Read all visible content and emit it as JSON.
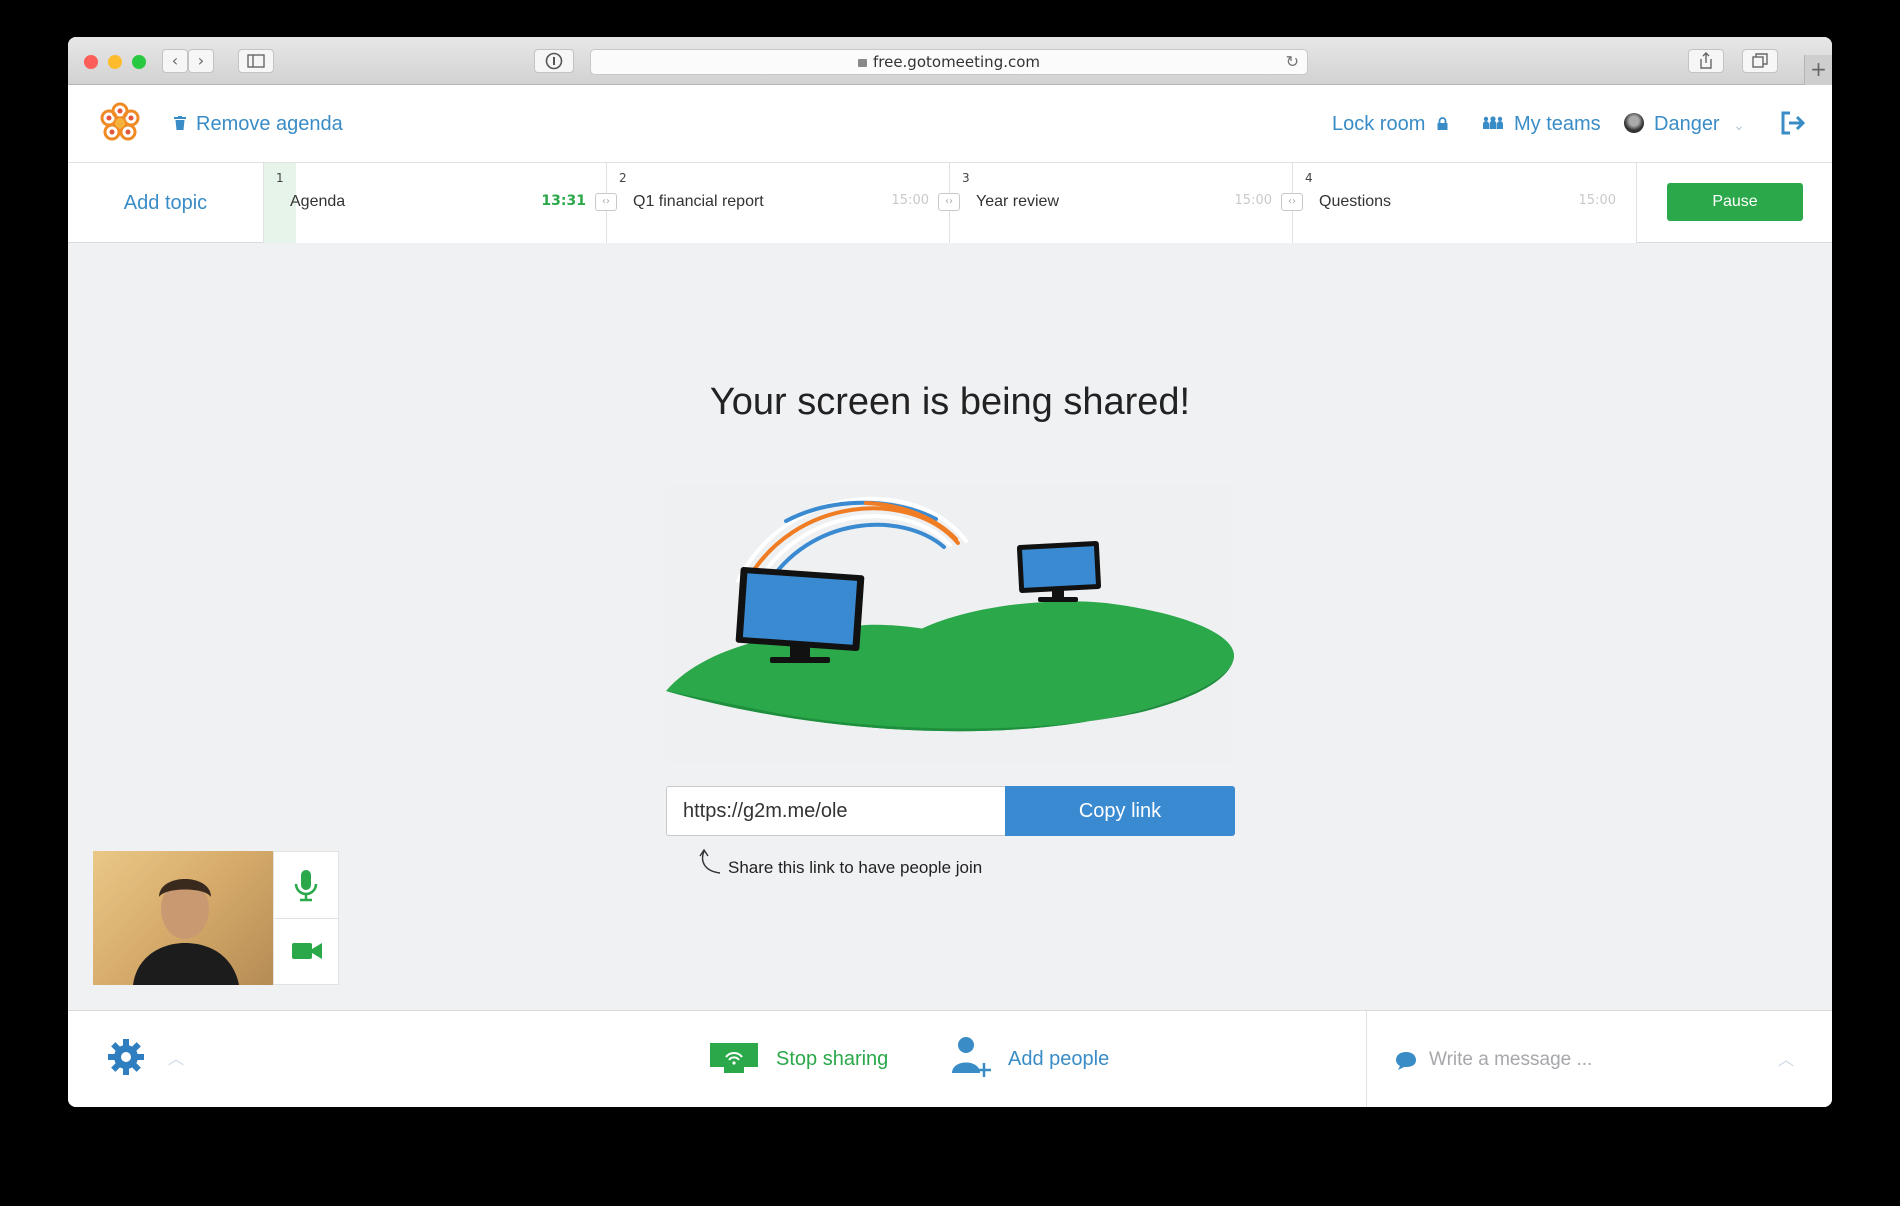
{
  "browser": {
    "url": "free.gotomeeting.com"
  },
  "header": {
    "remove_agenda": "Remove agenda",
    "lock_room": "Lock room",
    "my_teams": "My teams",
    "user_name": "Danger"
  },
  "agenda": {
    "add_topic": "Add topic",
    "topics": [
      {
        "number": "1",
        "name": "Agenda",
        "time": "13:31"
      },
      {
        "number": "2",
        "name": "Q1 financial report",
        "time": "15:00"
      },
      {
        "number": "3",
        "name": "Year review",
        "time": "15:00"
      },
      {
        "number": "4",
        "name": "Questions",
        "time": "15:00"
      }
    ],
    "pause_label": "Pause"
  },
  "main": {
    "title": "Your screen is being shared!",
    "share_link": "https://g2m.me/ole",
    "copy_link": "Copy link",
    "hint": "Share this link to have people join"
  },
  "bottom": {
    "stop_sharing": "Stop sharing",
    "add_people": "Add people",
    "message_placeholder": "Write a message ..."
  },
  "colors": {
    "accent_blue": "#3a8cc6",
    "button_blue": "#3a8ad1",
    "green": "#2aa84a",
    "logo_orange": "#f08a24"
  }
}
